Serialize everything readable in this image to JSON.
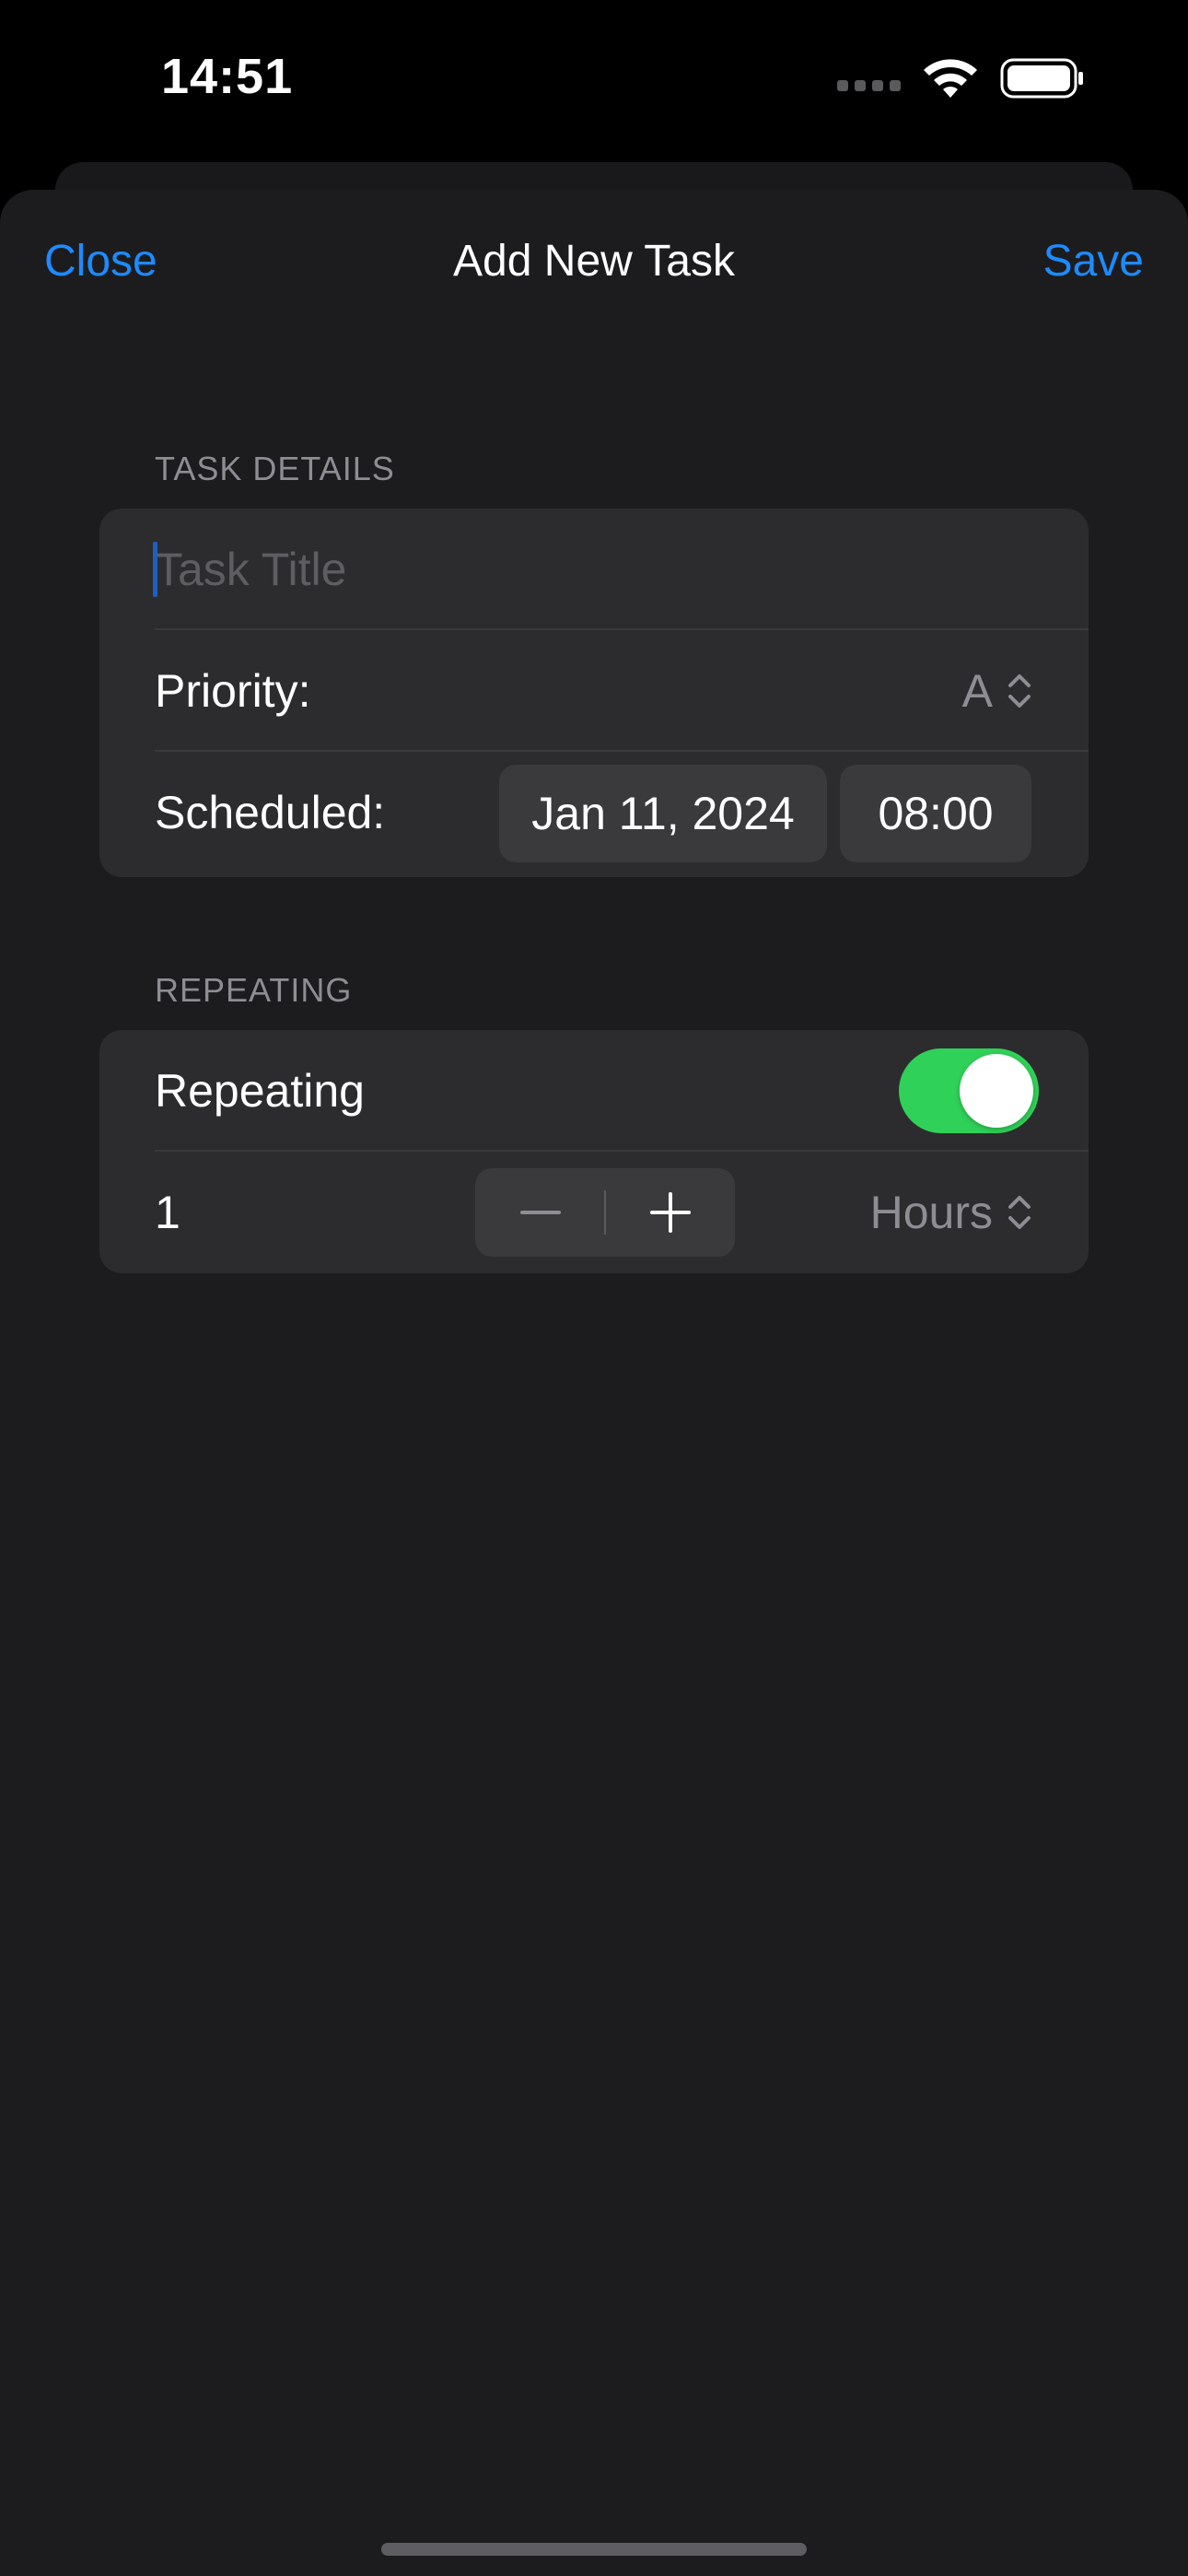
{
  "status_bar": {
    "time": "14:51"
  },
  "nav": {
    "close_label": "Close",
    "title": "Add New Task",
    "save_label": "Save"
  },
  "task_details": {
    "header": "TASK DETAILS",
    "title_placeholder": "Task Title",
    "title_value": "",
    "priority_label": "Priority:",
    "priority_value": "A",
    "scheduled_label": "Scheduled:",
    "scheduled_date": "Jan 11, 2024",
    "scheduled_time": "08:00"
  },
  "repeating": {
    "header": "REPEATING",
    "toggle_label": "Repeating",
    "toggle_on": true,
    "interval_value": "1",
    "unit_value": "Hours"
  },
  "colors": {
    "accent": "#1d8bff",
    "toggle_on": "#30d158",
    "background": "#1c1c1e",
    "group_background": "#2c2c2e"
  },
  "icons": {
    "wifi": "wifi-icon",
    "battery": "battery-icon",
    "signal": "cellular-signal-icon",
    "chevron": "chevron-up-down-icon",
    "minus": "minus-icon",
    "plus": "plus-icon"
  }
}
